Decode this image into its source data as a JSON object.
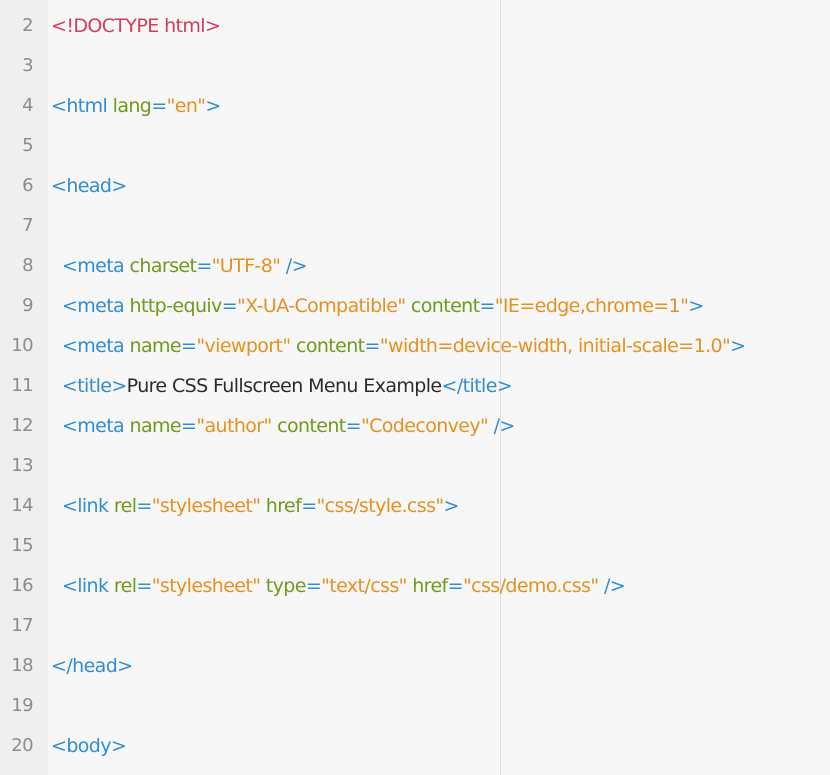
{
  "colors": {
    "background": "#f7f7f7",
    "gutter": "#efefef",
    "line_number": "#8c8c8c",
    "doctype": "#d53c5a",
    "tag": "#2f8dd8",
    "attribute": "#6f9a1c",
    "string": "#e7901d",
    "text": "#2b2b2b"
  },
  "lines": [
    {
      "num": "2",
      "tokens": [
        {
          "t": "doctype",
          "v": "<!DOCTYPE html>"
        }
      ]
    },
    {
      "num": "3",
      "tokens": []
    },
    {
      "num": "4",
      "tokens": [
        {
          "t": "tag",
          "v": "<html"
        },
        {
          "t": "attr",
          "v": " lang"
        },
        {
          "t": "tag",
          "v": "="
        },
        {
          "t": "str",
          "v": "\"en\""
        },
        {
          "t": "tag",
          "v": ">"
        }
      ]
    },
    {
      "num": "5",
      "tokens": []
    },
    {
      "num": "6",
      "tokens": [
        {
          "t": "tag",
          "v": "<head>"
        }
      ]
    },
    {
      "num": "7",
      "tokens": []
    },
    {
      "num": "8",
      "tokens": [
        {
          "t": "tag",
          "v": "  <meta"
        },
        {
          "t": "attr",
          "v": " charset"
        },
        {
          "t": "tag",
          "v": "="
        },
        {
          "t": "str",
          "v": "\"UTF-8\""
        },
        {
          "t": "tag",
          "v": " />"
        }
      ]
    },
    {
      "num": "9",
      "tokens": [
        {
          "t": "tag",
          "v": "  <meta"
        },
        {
          "t": "attr",
          "v": " http-equiv"
        },
        {
          "t": "tag",
          "v": "="
        },
        {
          "t": "str",
          "v": "\"X-UA-Compatible\""
        },
        {
          "t": "attr",
          "v": " content"
        },
        {
          "t": "tag",
          "v": "="
        },
        {
          "t": "str",
          "v": "\"IE=edge,chrome=1\""
        },
        {
          "t": "tag",
          "v": ">"
        }
      ]
    },
    {
      "num": "10",
      "tokens": [
        {
          "t": "tag",
          "v": "  <meta"
        },
        {
          "t": "attr",
          "v": " name"
        },
        {
          "t": "tag",
          "v": "="
        },
        {
          "t": "str",
          "v": "\"viewport\""
        },
        {
          "t": "attr",
          "v": " content"
        },
        {
          "t": "tag",
          "v": "="
        },
        {
          "t": "str",
          "v": "\"width=device-width, initial-scale=1.0\""
        },
        {
          "t": "tag",
          "v": ">"
        }
      ]
    },
    {
      "num": "11",
      "tokens": [
        {
          "t": "tag",
          "v": "  <title>"
        },
        {
          "t": "text",
          "v": "Pure CSS Fullscreen Menu Example"
        },
        {
          "t": "tag",
          "v": "</title>"
        }
      ]
    },
    {
      "num": "12",
      "tokens": [
        {
          "t": "tag",
          "v": "  <meta"
        },
        {
          "t": "attr",
          "v": " name"
        },
        {
          "t": "tag",
          "v": "="
        },
        {
          "t": "str",
          "v": "\"author\""
        },
        {
          "t": "attr",
          "v": " content"
        },
        {
          "t": "tag",
          "v": "="
        },
        {
          "t": "str",
          "v": "\"Codeconvey\""
        },
        {
          "t": "tag",
          "v": " />"
        }
      ]
    },
    {
      "num": "13",
      "tokens": []
    },
    {
      "num": "14",
      "tokens": [
        {
          "t": "tag",
          "v": "  <link"
        },
        {
          "t": "attr",
          "v": " rel"
        },
        {
          "t": "tag",
          "v": "="
        },
        {
          "t": "str",
          "v": "\"stylesheet\""
        },
        {
          "t": "attr",
          "v": " href"
        },
        {
          "t": "tag",
          "v": "="
        },
        {
          "t": "str",
          "v": "\"css/style.css\""
        },
        {
          "t": "tag",
          "v": ">"
        }
      ]
    },
    {
      "num": "15",
      "tokens": []
    },
    {
      "num": "16",
      "tokens": [
        {
          "t": "tag",
          "v": "  <link"
        },
        {
          "t": "attr",
          "v": " rel"
        },
        {
          "t": "tag",
          "v": "="
        },
        {
          "t": "str",
          "v": "\"stylesheet\""
        },
        {
          "t": "attr",
          "v": " type"
        },
        {
          "t": "tag",
          "v": "="
        },
        {
          "t": "str",
          "v": "\"text/css\""
        },
        {
          "t": "attr",
          "v": " href"
        },
        {
          "t": "tag",
          "v": "="
        },
        {
          "t": "str",
          "v": "\"css/demo.css\""
        },
        {
          "t": "tag",
          "v": " />"
        }
      ]
    },
    {
      "num": "17",
      "tokens": []
    },
    {
      "num": "18",
      "tokens": [
        {
          "t": "tag",
          "v": "</head>"
        }
      ]
    },
    {
      "num": "19",
      "tokens": []
    },
    {
      "num": "20",
      "tokens": [
        {
          "t": "tag",
          "v": "<body>"
        }
      ]
    }
  ]
}
